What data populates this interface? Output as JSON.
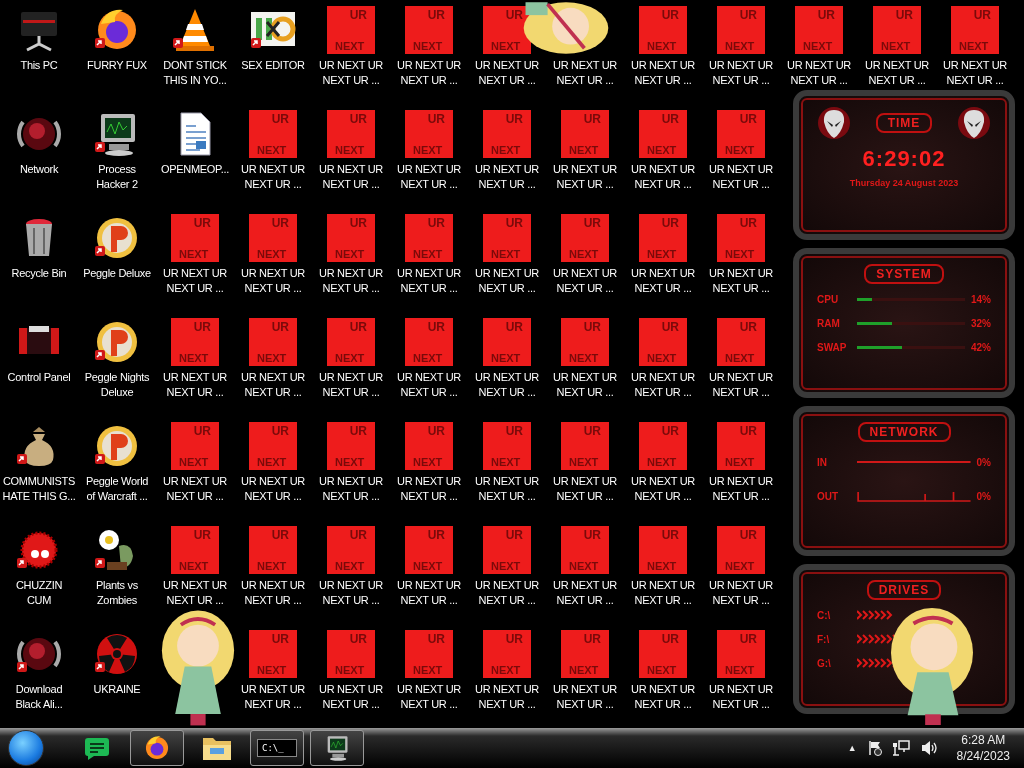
{
  "desktop": {
    "rows": [
      [
        {
          "kind": "pc",
          "shortcut": false,
          "lines": [
            "This PC"
          ]
        },
        {
          "kind": "firefox",
          "shortcut": true,
          "lines": [
            "FURRY FUX"
          ]
        },
        {
          "kind": "cone",
          "shortcut": true,
          "lines": [
            "DONT STICK",
            "THIS IN YO..."
          ]
        },
        {
          "kind": "hxd",
          "shortcut": true,
          "lines": [
            "SEX EDITOR"
          ]
        },
        {
          "kind": "urnext",
          "top": "UR",
          "bottom": "NEXT",
          "lines": [
            "UR NEXT UR",
            "NEXT UR ..."
          ]
        },
        {
          "kind": "urnext",
          "top": "UR",
          "bottom": "NEXT",
          "lines": [
            "UR NEXT UR",
            "NEXT UR ..."
          ]
        },
        {
          "kind": "urnext",
          "top": "UR",
          "bottom": "NEXT",
          "lines": [
            "UR NEXT UR",
            "NEXT UR ..."
          ]
        },
        {
          "kind": "hidden",
          "lines": [
            "UR NEXT UR",
            "NEXT UR ..."
          ]
        },
        {
          "kind": "urnext",
          "top": "UR",
          "bottom": "NEXT",
          "lines": [
            "UR NEXT UR",
            "NEXT UR ..."
          ]
        },
        {
          "kind": "urnext",
          "top": "UR",
          "bottom": "NEXT",
          "lines": [
            "UR NEXT UR",
            "NEXT UR ..."
          ]
        },
        {
          "kind": "urnext",
          "top": "UR",
          "bottom": "NEXT",
          "lines": [
            "UR NEXT UR",
            "NEXT UR ..."
          ]
        },
        {
          "kind": "urnext",
          "top": "UR",
          "bottom": "NEXT",
          "lines": [
            "UR NEXT UR",
            "NEXT UR ..."
          ]
        },
        {
          "kind": "urnext",
          "top": "UR",
          "bottom": "NEXT",
          "lines": [
            "UR NEXT UR",
            "NEXT UR ..."
          ]
        }
      ],
      [
        {
          "kind": "network",
          "shortcut": false,
          "lines": [
            "Network"
          ]
        },
        {
          "kind": "monitor",
          "shortcut": true,
          "lines": [
            "Process",
            "Hacker 2"
          ]
        },
        {
          "kind": "document",
          "shortcut": false,
          "lines": [
            "OPENMEOP..."
          ]
        },
        {
          "kind": "urnext",
          "top": "UR",
          "bottom": "NEXT",
          "lines": [
            "UR NEXT UR",
            "NEXT UR ..."
          ]
        },
        {
          "kind": "urnext",
          "top": "UR",
          "bottom": "NEXT",
          "lines": [
            "UR NEXT UR",
            "NEXT UR ..."
          ]
        },
        {
          "kind": "urnext",
          "top": "UR",
          "bottom": "NEXT",
          "lines": [
            "UR NEXT UR",
            "NEXT UR ..."
          ]
        },
        {
          "kind": "urnext",
          "top": "UR",
          "bottom": "NEXT",
          "lines": [
            "UR NEXT UR",
            "NEXT UR ..."
          ]
        },
        {
          "kind": "urnext",
          "top": "UR",
          "bottom": "NEXT",
          "lines": [
            "UR NEXT UR",
            "NEXT UR ..."
          ]
        },
        {
          "kind": "urnext",
          "top": "UR",
          "bottom": "NEXT",
          "lines": [
            "UR NEXT UR",
            "NEXT UR ..."
          ]
        },
        {
          "kind": "urnext",
          "top": "UR",
          "bottom": "NEXT",
          "lines": [
            "UR NEXT UR",
            "NEXT UR ..."
          ]
        }
      ],
      [
        {
          "kind": "recycle",
          "shortcut": false,
          "lines": [
            "Recycle Bin"
          ]
        },
        {
          "kind": "peggle",
          "shortcut": true,
          "lines": [
            "Peggle Deluxe"
          ]
        },
        {
          "kind": "urnext",
          "top": "UR",
          "bottom": "NEXT",
          "lines": [
            "UR NEXT UR",
            "NEXT UR ..."
          ]
        },
        {
          "kind": "urnext",
          "top": "UR",
          "bottom": "NEXT",
          "lines": [
            "UR NEXT UR",
            "NEXT UR ..."
          ]
        },
        {
          "kind": "urnext",
          "top": "UR",
          "bottom": "NEXT",
          "lines": [
            "UR NEXT UR",
            "NEXT UR ..."
          ]
        },
        {
          "kind": "urnext",
          "top": "UR",
          "bottom": "NEXT",
          "lines": [
            "UR NEXT UR",
            "NEXT UR ..."
          ]
        },
        {
          "kind": "urnext",
          "top": "UR",
          "bottom": "NEXT",
          "lines": [
            "UR NEXT UR",
            "NEXT UR ..."
          ]
        },
        {
          "kind": "urnext",
          "top": "UR",
          "bottom": "NEXT",
          "lines": [
            "UR NEXT UR",
            "NEXT UR ..."
          ]
        },
        {
          "kind": "urnext",
          "top": "UR",
          "bottom": "NEXT",
          "lines": [
            "UR NEXT UR",
            "NEXT UR ..."
          ]
        },
        {
          "kind": "urnext",
          "top": "UR",
          "bottom": "NEXT",
          "lines": [
            "UR NEXT UR",
            "NEXT UR ..."
          ]
        }
      ],
      [
        {
          "kind": "controlpanel",
          "shortcut": false,
          "lines": [
            "Control Panel"
          ]
        },
        {
          "kind": "peggle",
          "shortcut": true,
          "lines": [
            "Peggle Nights",
            "Deluxe"
          ]
        },
        {
          "kind": "urnext",
          "top": "UR",
          "bottom": "NEXT",
          "lines": [
            "UR NEXT UR",
            "NEXT UR ..."
          ]
        },
        {
          "kind": "urnext",
          "top": "UR",
          "bottom": "NEXT",
          "lines": [
            "UR NEXT UR",
            "NEXT UR ..."
          ]
        },
        {
          "kind": "urnext",
          "top": "UR",
          "bottom": "NEXT",
          "lines": [
            "UR NEXT UR",
            "NEXT UR ..."
          ]
        },
        {
          "kind": "urnext",
          "top": "UR",
          "bottom": "NEXT",
          "lines": [
            "UR NEXT UR",
            "NEXT UR ..."
          ]
        },
        {
          "kind": "urnext",
          "top": "UR",
          "bottom": "NEXT",
          "lines": [
            "UR NEXT UR",
            "NEXT UR ..."
          ]
        },
        {
          "kind": "urnext",
          "top": "UR",
          "bottom": "NEXT",
          "lines": [
            "UR NEXT UR",
            "NEXT UR ..."
          ]
        },
        {
          "kind": "urnext",
          "top": "UR",
          "bottom": "NEXT",
          "lines": [
            "UR NEXT UR",
            "NEXT UR ..."
          ]
        },
        {
          "kind": "urnext",
          "top": "UR",
          "bottom": "NEXT",
          "lines": [
            "UR NEXT UR",
            "NEXT UR ..."
          ]
        }
      ],
      [
        {
          "kind": "moneybag",
          "shortcut": true,
          "lines": [
            "COMMUNISTS",
            "HATE THIS G..."
          ]
        },
        {
          "kind": "peggle",
          "shortcut": true,
          "lines": [
            "Peggle World",
            "of Warcraft ..."
          ]
        },
        {
          "kind": "urnext",
          "top": "UR",
          "bottom": "NEXT",
          "lines": [
            "UR NEXT UR",
            "NEXT UR ..."
          ]
        },
        {
          "kind": "urnext",
          "top": "UR",
          "bottom": "NEXT",
          "lines": [
            "UR NEXT UR",
            "NEXT UR ..."
          ]
        },
        {
          "kind": "urnext",
          "top": "UR",
          "bottom": "NEXT",
          "lines": [
            "UR NEXT UR",
            "NEXT UR ..."
          ]
        },
        {
          "kind": "urnext",
          "top": "UR",
          "bottom": "NEXT",
          "lines": [
            "UR NEXT UR",
            "NEXT UR ..."
          ]
        },
        {
          "kind": "urnext",
          "top": "UR",
          "bottom": "NEXT",
          "lines": [
            "UR NEXT UR",
            "NEXT UR ..."
          ]
        },
        {
          "kind": "urnext",
          "top": "UR",
          "bottom": "NEXT",
          "lines": [
            "UR NEXT UR",
            "NEXT UR ..."
          ]
        },
        {
          "kind": "urnext",
          "top": "UR",
          "bottom": "NEXT",
          "lines": [
            "UR NEXT UR",
            "NEXT UR ..."
          ]
        },
        {
          "kind": "urnext",
          "top": "UR",
          "bottom": "NEXT",
          "lines": [
            "UR NEXT UR",
            "NEXT UR ..."
          ]
        }
      ],
      [
        {
          "kind": "chuzzle",
          "shortcut": true,
          "lines": [
            "CHUZZIN",
            "CUM"
          ]
        },
        {
          "kind": "plant",
          "shortcut": true,
          "lines": [
            "Plants vs",
            "Zombies"
          ]
        },
        {
          "kind": "urnext",
          "top": "UR",
          "bottom": "NEXT",
          "lines": [
            "UR NEXT UR",
            "NEXT UR ..."
          ]
        },
        {
          "kind": "urnext",
          "top": "UR",
          "bottom": "NEXT",
          "lines": [
            "UR NEXT UR",
            "NEXT UR ..."
          ]
        },
        {
          "kind": "urnext",
          "top": "UR",
          "bottom": "NEXT",
          "lines": [
            "UR NEXT UR",
            "NEXT UR ..."
          ]
        },
        {
          "kind": "urnext",
          "top": "UR",
          "bottom": "NEXT",
          "lines": [
            "UR NEXT UR",
            "NEXT UR ..."
          ]
        },
        {
          "kind": "urnext",
          "top": "UR",
          "bottom": "NEXT",
          "lines": [
            "UR NEXT UR",
            "NEXT UR ..."
          ]
        },
        {
          "kind": "urnext",
          "top": "UR",
          "bottom": "NEXT",
          "lines": [
            "UR NEXT UR",
            "NEXT UR ..."
          ]
        },
        {
          "kind": "urnext",
          "top": "UR",
          "bottom": "NEXT",
          "lines": [
            "UR NEXT UR",
            "NEXT UR ..."
          ]
        },
        {
          "kind": "urnext",
          "top": "UR",
          "bottom": "NEXT",
          "lines": [
            "UR NEXT UR",
            "NEXT UR ..."
          ]
        }
      ],
      [
        {
          "kind": "alien",
          "shortcut": true,
          "lines": [
            "Download",
            "Black Ali..."
          ]
        },
        {
          "kind": "radiation",
          "shortcut": true,
          "lines": [
            "UKRAINE"
          ]
        },
        {
          "kind": "hidden"
        },
        {
          "kind": "urnext",
          "top": "UR",
          "bottom": "NEXT",
          "lines": [
            "UR NEXT UR",
            "NEXT UR ..."
          ]
        },
        {
          "kind": "urnext",
          "top": "UR",
          "bottom": "NEXT",
          "lines": [
            "UR NEXT UR",
            "NEXT UR ..."
          ]
        },
        {
          "kind": "urnext",
          "top": "UR",
          "bottom": "NEXT",
          "lines": [
            "UR NEXT UR",
            "NEXT UR ..."
          ]
        },
        {
          "kind": "urnext",
          "top": "UR",
          "bottom": "NEXT",
          "lines": [
            "UR NEXT UR",
            "NEXT UR ..."
          ]
        },
        {
          "kind": "urnext",
          "top": "UR",
          "bottom": "NEXT",
          "lines": [
            "UR NEXT UR",
            "NEXT UR ..."
          ]
        },
        {
          "kind": "urnext",
          "top": "UR",
          "bottom": "NEXT",
          "lines": [
            "UR NEXT UR",
            "NEXT UR ..."
          ]
        },
        {
          "kind": "urnext",
          "top": "UR",
          "bottom": "NEXT",
          "lines": [
            "UR NEXT UR",
            "NEXT UR ..."
          ]
        }
      ]
    ]
  },
  "widget": {
    "time": {
      "title": "TIME",
      "clock": "6:29:02",
      "date": "Thursday 24 August 2023"
    },
    "system": {
      "title": "SYSTEM",
      "meters": [
        {
          "name": "CPU",
          "level": 0.14,
          "reading": "14%"
        },
        {
          "name": "RAM",
          "level": 0.32,
          "reading": "32%"
        },
        {
          "name": "SWAP",
          "level": 0.42,
          "reading": "42%"
        }
      ]
    },
    "network": {
      "title": "NETWORK",
      "lines": [
        {
          "name": "IN",
          "reading": "0%"
        },
        {
          "name": "OUT",
          "reading": "0%"
        }
      ]
    },
    "drives": {
      "title": "DRIVES",
      "items": [
        {
          "name": "C:\\"
        },
        {
          "name": "F:\\"
        },
        {
          "name": "G:\\"
        }
      ]
    }
  },
  "taskbar": {
    "items": [
      {
        "kind": "orb",
        "running": false
      },
      {
        "kind": "chat",
        "running": false
      },
      {
        "kind": "firefox",
        "running": true
      },
      {
        "kind": "explorer",
        "running": false
      },
      {
        "kind": "cmd",
        "running": true,
        "text": "C:\\_"
      },
      {
        "kind": "monitor",
        "running": true
      }
    ],
    "tray": {
      "overflow": "▲",
      "time": "6:28 AM",
      "date": "8/24/2023"
    }
  }
}
